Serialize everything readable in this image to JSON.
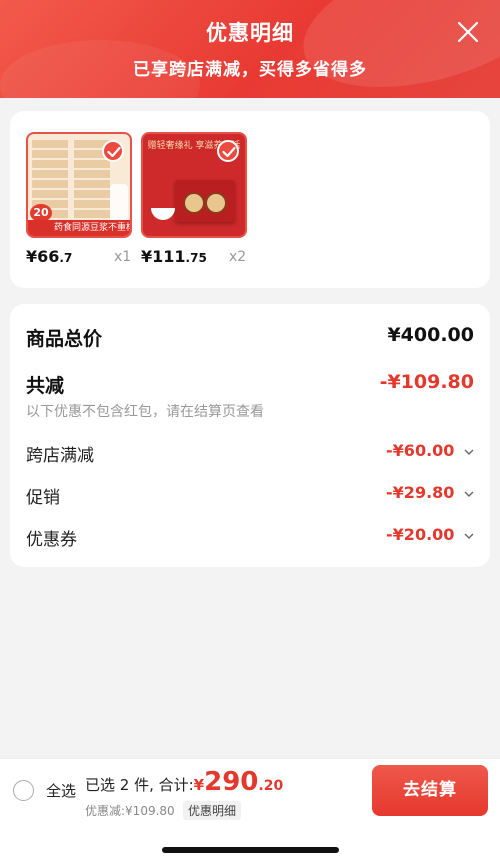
{
  "header": {
    "title": "优惠明细",
    "subtitle": "已享跨店满减，买得多省得多"
  },
  "products": [
    {
      "price_int": "¥66",
      "price_dec": ".7",
      "qty": "x1",
      "thumb_badge": "20",
      "thumb_strip": "药食同源豆浆不重样"
    },
    {
      "price_int": "¥111",
      "price_dec": ".75",
      "qty": "x2",
      "thumb_headline": "赠轻奢缘礼 享滋养生活"
    }
  ],
  "summary": {
    "total_label": "商品总价",
    "total_value": "¥400.00",
    "reduce_label": "共减",
    "reduce_value": "-¥109.80",
    "note": "以下优惠不包含红包，请在结算页查看",
    "items": [
      {
        "label": "跨店满减",
        "value": "-¥60.00"
      },
      {
        "label": "促销",
        "value": "-¥29.80"
      },
      {
        "label": "优惠券",
        "value": "-¥20.00"
      }
    ]
  },
  "footer": {
    "select_all": "全选",
    "selected_text": "已选 2 件, 合计:",
    "currency": "¥",
    "total_int": "290",
    "total_dec": ".20",
    "discount_text": "优惠减:¥109.80",
    "detail_label": "优惠明细",
    "checkout_label": "去结算"
  },
  "colors": {
    "accent": "#e5382d",
    "header_start": "#f25a4a",
    "header_end": "#e83a33",
    "background": "#f3f3f3"
  },
  "icons": [
    "close-icon",
    "check-icon",
    "chevron-down-icon",
    "radio-icon"
  ]
}
